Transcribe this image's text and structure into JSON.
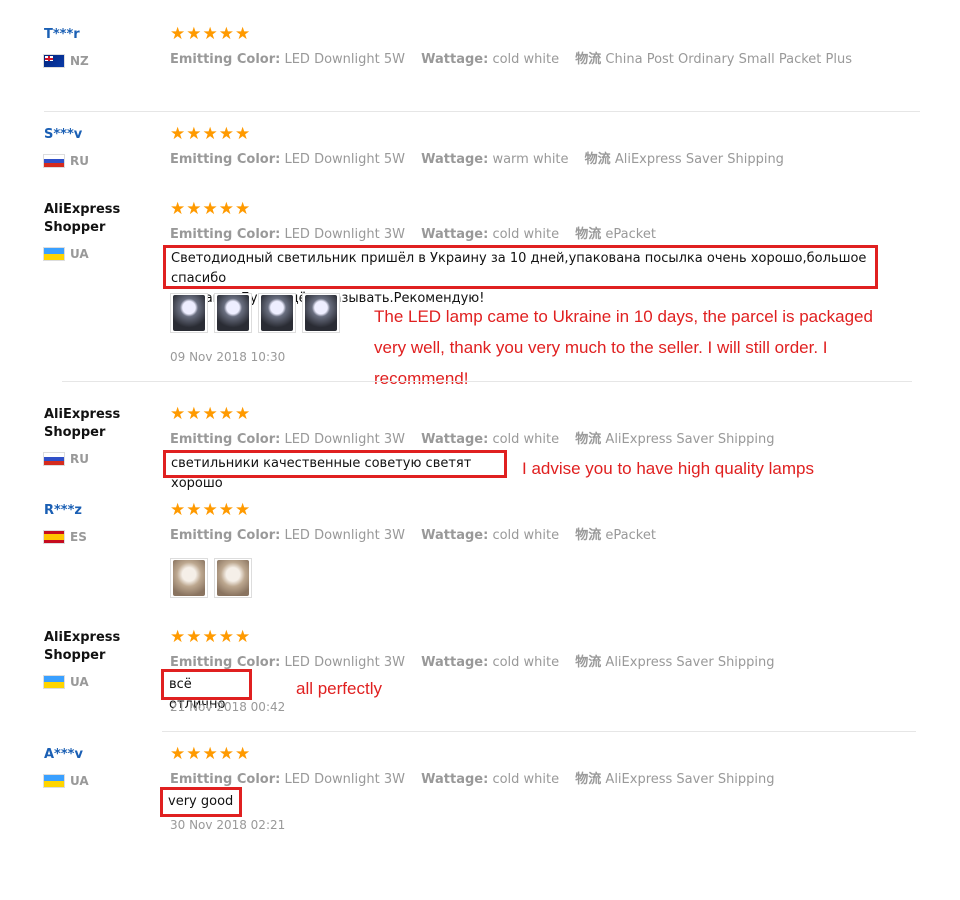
{
  "labels": {
    "emitting_color": "Emitting Color:",
    "wattage": "Wattage:",
    "shipping": "物流"
  },
  "reviews": [
    {
      "user": "T***r",
      "country": "NZ",
      "flag": "nz-flag",
      "rating": 5,
      "color": "LED Downlight 5W",
      "wattage": "cold white",
      "shipping": "China Post Ordinary Small Packet Plus"
    },
    {
      "user": "S***v",
      "country": "RU",
      "flag": "ru-flag",
      "rating": 5,
      "color": "LED Downlight 5W",
      "wattage": "warm white",
      "shipping": "AliExpress Saver Shipping"
    },
    {
      "user": "AliExpress Shopper",
      "country": "UA",
      "flag": "ua-flag",
      "rating": 5,
      "color": "LED Downlight 3W",
      "wattage": "cold white",
      "shipping": "ePacket",
      "text_line1": "Светодиодный светильник пришёл в Украину за 10 дней,упакована посылка очень хорошо,большое спасибо",
      "text_line2": "продавцу.Буду ещё заказывать.Рекомендую!",
      "translation_line1": "The LED lamp came to Ukraine in 10 days, the parcel is packaged",
      "translation_line2": "very well, thank you very much to the seller. I will still order. I",
      "translation_line3": "recommend!",
      "date": "09 Nov 2018 10:30"
    },
    {
      "user": "AliExpress Shopper",
      "country": "RU",
      "flag": "ru-flag",
      "rating": 5,
      "color": "LED Downlight 3W",
      "wattage": "cold white",
      "shipping": "AliExpress Saver Shipping",
      "text": "светильники качественные советую светят хорошо",
      "translation": "I advise you to have high quality lamps"
    },
    {
      "user": "R***z",
      "country": "ES",
      "flag": "es-flag",
      "rating": 5,
      "color": "LED Downlight 3W",
      "wattage": "cold white",
      "shipping": "ePacket"
    },
    {
      "user": "AliExpress Shopper",
      "country": "UA",
      "flag": "ua-flag",
      "rating": 5,
      "color": "LED Downlight 3W",
      "wattage": "cold white",
      "shipping": "AliExpress Saver Shipping",
      "text": "всё отлично",
      "translation": "all perfectly",
      "date": "21 Nov 2018 00:42"
    },
    {
      "user": "A***v",
      "country": "UA",
      "flag": "ua-flag",
      "rating": 5,
      "color": "LED Downlight 3W",
      "wattage": "cold white",
      "shipping": "AliExpress Saver Shipping",
      "text": "very good",
      "date": "30 Nov 2018 02:21"
    }
  ],
  "colors": {
    "star": "#ff9a00",
    "highlight": "#e02020",
    "username_link": "#1a5fb4",
    "muted": "#999999"
  }
}
